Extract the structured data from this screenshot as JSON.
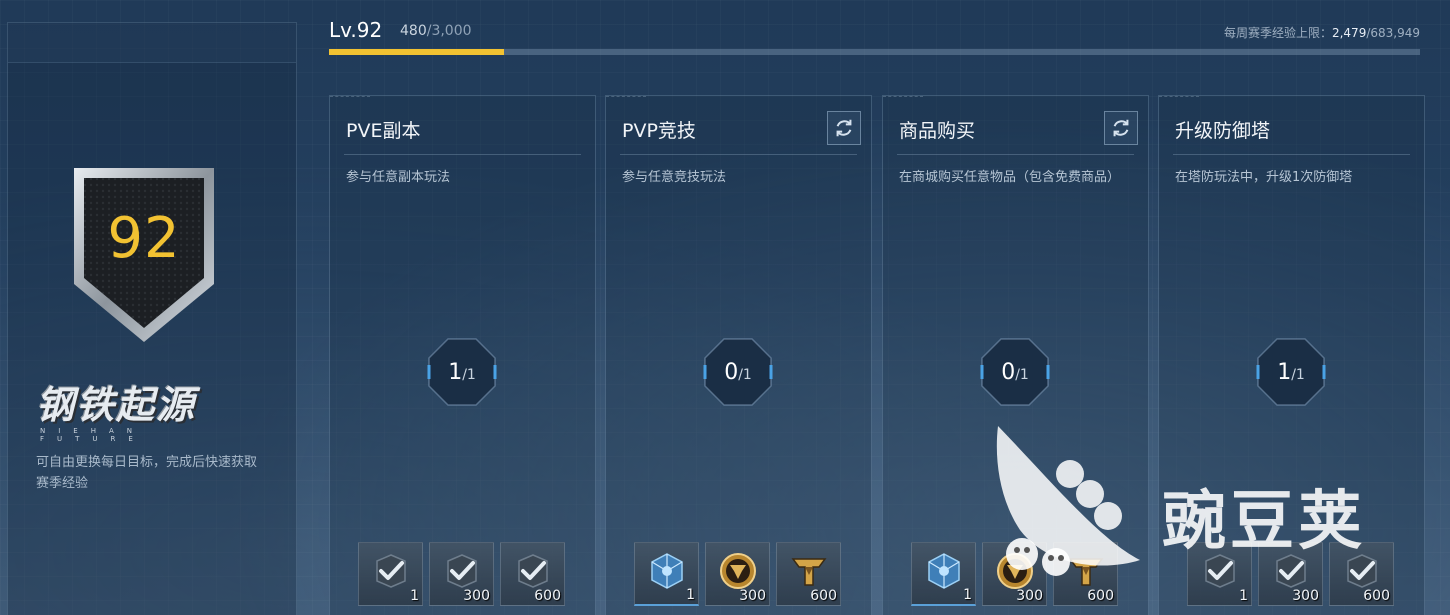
{
  "player": {
    "level_label": "Lv.92",
    "exp_current": "480",
    "exp_max": "/3,000",
    "progress_fraction": 0.16,
    "weekly_label": "每周赛季经验上限：",
    "weekly_current": "2,479",
    "weekly_max": "/683,949"
  },
  "left": {
    "rank": "92",
    "logo_cn": "钢铁起源",
    "logo_en": "NIEHAN FUTURE",
    "description": "可自由更换每日目标，完成后快速获取赛季经验"
  },
  "cards": [
    {
      "title": "PVE副本",
      "desc": "参与任意副本玩法",
      "refresh": false,
      "done": "1",
      "total": "/1",
      "rewards": [
        {
          "icon": "checkmark-badge-icon",
          "qty": "1"
        },
        {
          "icon": "checkmark-badge-icon",
          "qty": "300"
        },
        {
          "icon": "checkmark-badge-icon",
          "qty": "600"
        }
      ]
    },
    {
      "title": "PVP竞技",
      "desc": "参与任意竞技玩法",
      "refresh": true,
      "done": "0",
      "total": "/1",
      "rewards": [
        {
          "icon": "crystal-cube-icon",
          "qty": "1"
        },
        {
          "icon": "gold-coin-icon",
          "qty": "300"
        },
        {
          "icon": "gold-emblem-icon",
          "qty": "600"
        }
      ]
    },
    {
      "title": "商品购买",
      "desc": "在商城购买任意物品（包含免费商品）",
      "refresh": true,
      "done": "0",
      "total": "/1",
      "rewards": [
        {
          "icon": "crystal-cube-icon",
          "qty": "1"
        },
        {
          "icon": "gold-coin-icon",
          "qty": "300"
        },
        {
          "icon": "gold-emblem-icon",
          "qty": "600"
        }
      ]
    },
    {
      "title": "升级防御塔",
      "desc": "在塔防玩法中，升级1次防御塔",
      "refresh": false,
      "done": "1",
      "total": "/1",
      "rewards": [
        {
          "icon": "checkmark-badge-icon",
          "qty": "1"
        },
        {
          "icon": "checkmark-badge-icon",
          "qty": "300"
        },
        {
          "icon": "checkmark-badge-icon",
          "qty": "600"
        }
      ]
    }
  ],
  "watermark": "豌豆荚",
  "colors": {
    "accent": "#f2c232",
    "active_underline": "#5aa0d8"
  }
}
